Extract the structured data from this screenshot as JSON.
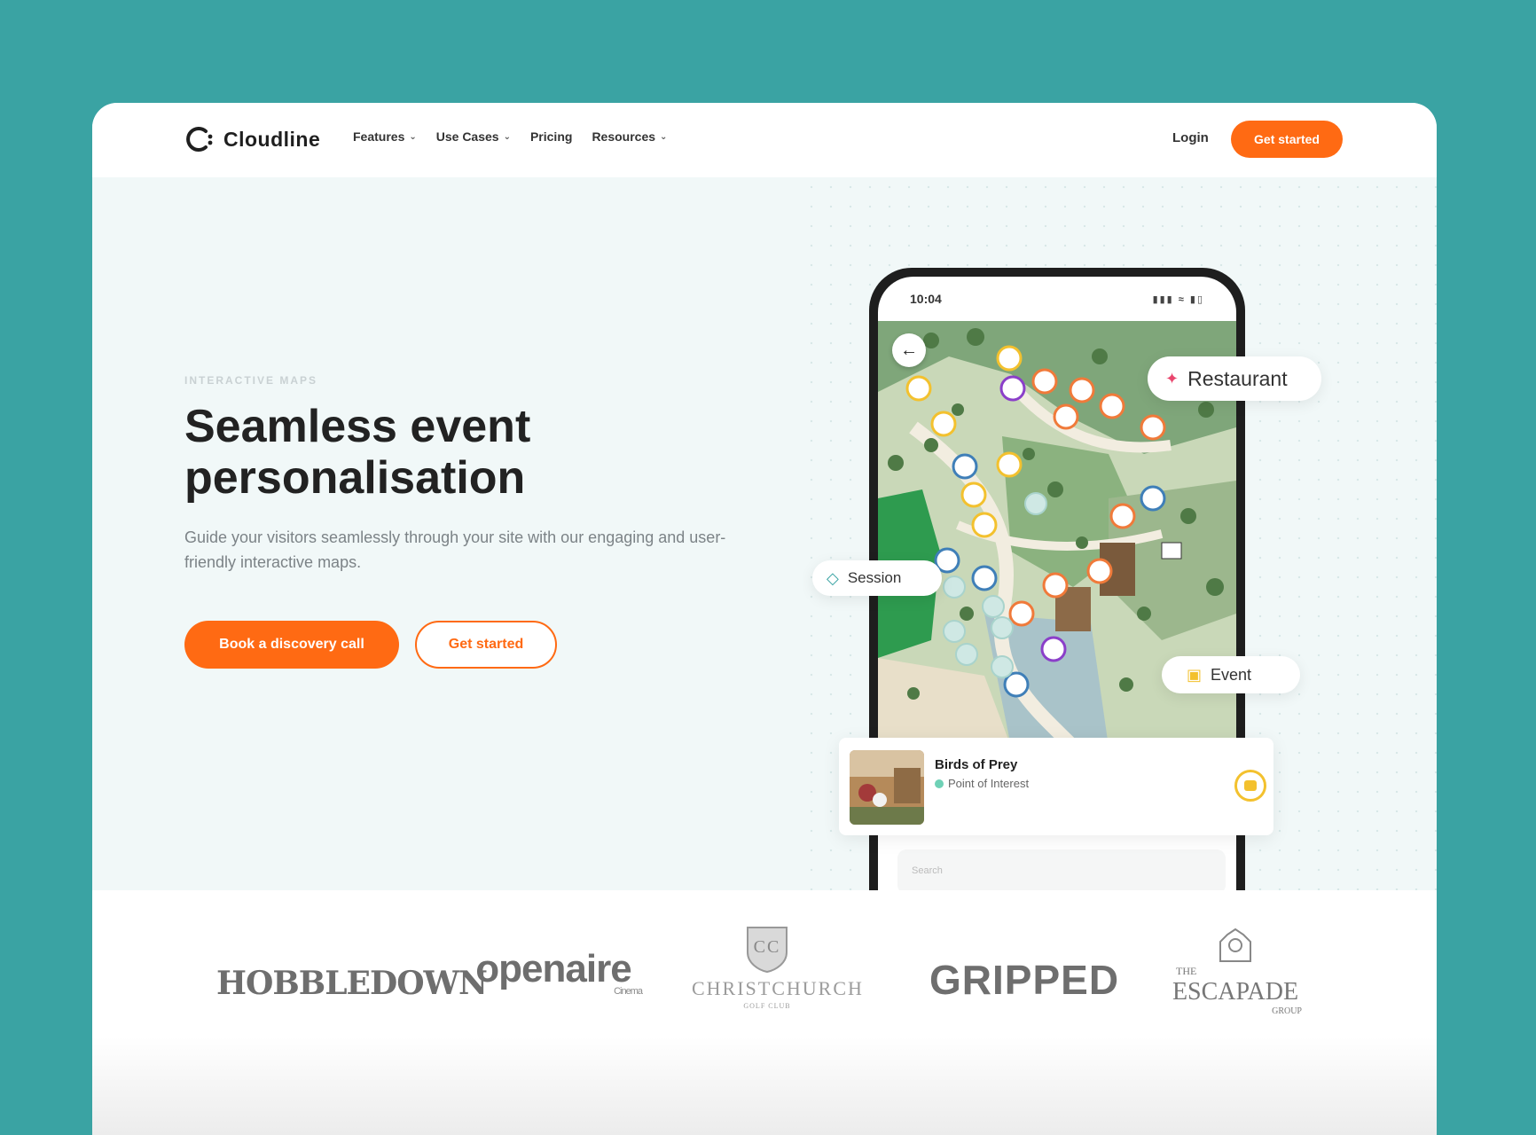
{
  "brand": {
    "name": "Cloudline"
  },
  "nav": {
    "menu": [
      {
        "label": "Features",
        "has_dropdown": true
      },
      {
        "label": "Use Cases",
        "has_dropdown": true
      },
      {
        "label": "Pricing",
        "has_dropdown": false
      },
      {
        "label": "Resources",
        "has_dropdown": true
      }
    ],
    "login_label": "Login",
    "cta_label": "Get started"
  },
  "hero": {
    "eyebrow": "INTERACTIVE MAPS",
    "headline": "Seamless event personalisation",
    "subtext": "Guide your visitors seamlessly through your site with our engaging and user-friendly interactive maps.",
    "primary_button": "Book a discovery call",
    "secondary_button": "Get started"
  },
  "phone": {
    "time": "10:04",
    "search_placeholder": "Search"
  },
  "callouts": {
    "restaurant": "Restaurant",
    "session": "Session",
    "event": "Event"
  },
  "poi_card": {
    "title": "Birds of Prey",
    "category": "Point of Interest"
  },
  "logos": {
    "hobbledown": "HOBBLEDOWN",
    "openaire": "openaire",
    "openaire_sub": "Cinema",
    "christchurch": "CHRISTCHURCH",
    "christchurch_sub": "GOLF CLUB",
    "gripped": "GRIPPED",
    "escapade_the": "THE",
    "escapade": "ESCAPADE",
    "escapade_sub": "GROUP"
  },
  "colors": {
    "background": "#3aa3a3",
    "accent": "#ff6a13",
    "hero_bg": "#f1f8f8",
    "map_green": "#7fa67a",
    "pin_orange": "#f07a3a",
    "pin_yellow": "#f3c12e",
    "pin_blue": "#3f7fb8",
    "pin_purple": "#8b3fc9"
  }
}
